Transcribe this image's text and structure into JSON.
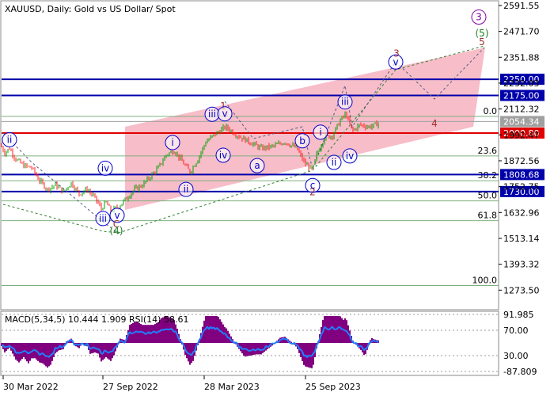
{
  "title": "XAUUSD, Daily:  Gold vs US Dollar/ Spot",
  "colors": {
    "bull": "#00a000",
    "bear": "#ff2020",
    "channel": "#f6b2c0",
    "blue_level": "#0000aa",
    "red_level": "#e00000",
    "fib_line": "#80b080",
    "circle": "#0000cc",
    "wave_major": "#a03030",
    "wave_green": "#208020",
    "wave_purple": "#8000a0",
    "macd_pos": "#800080",
    "macd_line": "#2080ff"
  },
  "chart_data": {
    "type": "candlestick",
    "symbol": "XAUUSD",
    "timeframe": "Daily",
    "y_axis_ticks": [
      "2591.55",
      "2471.70",
      "2351.88",
      "2232.03",
      "2112.32",
      "1992.47",
      "1872.56",
      "1752.75",
      "1632.96",
      "1513.14",
      "1393.32",
      "1273.50"
    ],
    "ylim": [
      1205,
      2595
    ],
    "x_axis_labels": [
      "30 Mar 2022",
      "27 Sep 2022",
      "28 Mar 2023",
      "25 Sep 2023"
    ],
    "price_path": [
      [
        0,
        1950
      ],
      [
        6,
        1910
      ],
      [
        12,
        1930
      ],
      [
        20,
        1880
      ],
      [
        30,
        1850
      ],
      [
        40,
        1840
      ],
      [
        50,
        1780
      ],
      [
        60,
        1740
      ],
      [
        70,
        1760
      ],
      [
        80,
        1730
      ],
      [
        90,
        1770
      ],
      [
        100,
        1720
      ],
      [
        110,
        1740
      ],
      [
        120,
        1700
      ],
      [
        128,
        1650
      ],
      [
        134,
        1680
      ],
      [
        140,
        1640
      ],
      [
        150,
        1660
      ],
      [
        160,
        1700
      ],
      [
        170,
        1740
      ],
      [
        180,
        1760
      ],
      [
        190,
        1800
      ],
      [
        200,
        1840
      ],
      [
        210,
        1900
      ],
      [
        220,
        1920
      ],
      [
        230,
        1870
      ],
      [
        240,
        1820
      ],
      [
        250,
        1880
      ],
      [
        260,
        1960
      ],
      [
        270,
        1990
      ],
      [
        285,
        2030
      ],
      [
        300,
        1990
      ],
      [
        315,
        1960
      ],
      [
        330,
        1930
      ],
      [
        345,
        1940
      ],
      [
        360,
        1960
      ],
      [
        375,
        1930
      ],
      [
        385,
        1860
      ],
      [
        395,
        1830
      ],
      [
        400,
        1900
      ],
      [
        410,
        1980
      ],
      [
        420,
        1990
      ],
      [
        430,
        2060
      ],
      [
        437,
        2090
      ],
      [
        445,
        2010
      ],
      [
        455,
        2040
      ],
      [
        465,
        2030
      ],
      [
        472,
        2035
      ],
      [
        480,
        2052
      ]
    ],
    "levels": [
      {
        "label": "2250.00",
        "value": 2250.0,
        "color": "blue"
      },
      {
        "label": "2175.00",
        "value": 2175.0,
        "color": "blue"
      },
      {
        "label": "2054.34",
        "value": 2054.34,
        "color": "gray"
      },
      {
        "label": "2000.80",
        "value": 2000.8,
        "color": "red"
      },
      {
        "label": "1808.68",
        "value": 1808.68,
        "color": "blue"
      },
      {
        "label": "1730.00",
        "value": 1730.0,
        "color": "blue"
      }
    ],
    "fibonacci": [
      {
        "label": "0.0",
        "value": 2078
      },
      {
        "label": "23.6",
        "value": 1895
      },
      {
        "label": "38.2",
        "value": 1780
      },
      {
        "label": "50.0",
        "value": 1687
      },
      {
        "label": "61.8",
        "value": 1595
      },
      {
        "label": "100.0",
        "value": 1295
      }
    ],
    "wave_labels": [
      {
        "text": "ii",
        "x": 12,
        "value": 1970,
        "style": "circle"
      },
      {
        "text": "iii",
        "x": 130,
        "value": 1605,
        "style": "circle"
      },
      {
        "text": "iv",
        "x": 133,
        "value": 1838,
        "style": "circle"
      },
      {
        "text": "v",
        "x": 148,
        "value": 1620,
        "style": "circle"
      },
      {
        "text": "C",
        "x": 147,
        "value": 1580,
        "style": "major"
      },
      {
        "text": "(4)",
        "x": 147,
        "value": 1548,
        "style": "green"
      },
      {
        "text": "i",
        "x": 218,
        "value": 1957,
        "style": "circle"
      },
      {
        "text": "ii",
        "x": 235,
        "value": 1740,
        "style": "circle"
      },
      {
        "text": "1",
        "x": 282,
        "value": 2126,
        "style": "major"
      },
      {
        "text": "iii",
        "x": 268,
        "value": 2088,
        "style": "circle"
      },
      {
        "text": "v",
        "x": 284,
        "value": 2090,
        "style": "circle"
      },
      {
        "text": "iv",
        "x": 282,
        "value": 1898,
        "style": "circle"
      },
      {
        "text": "a",
        "x": 325,
        "value": 1850,
        "style": "circle"
      },
      {
        "text": "b",
        "x": 382,
        "value": 1965,
        "style": "circle"
      },
      {
        "text": "c",
        "x": 395,
        "value": 1758,
        "style": "circle"
      },
      {
        "text": "2",
        "x": 395,
        "value": 1728,
        "style": "major"
      },
      {
        "text": "i",
        "x": 405,
        "value": 2005,
        "style": "circle"
      },
      {
        "text": "ii",
        "x": 422,
        "value": 1865,
        "style": "circle"
      },
      {
        "text": "iii",
        "x": 436,
        "value": 2145,
        "style": "circle"
      },
      {
        "text": "iv",
        "x": 442,
        "value": 1895,
        "style": "circle"
      },
      {
        "text": "v",
        "x": 500,
        "value": 2330,
        "style": "circle"
      },
      {
        "text": "3",
        "x": 501,
        "value": 2370,
        "style": "major"
      },
      {
        "text": "4",
        "x": 549,
        "value": 2045,
        "style": "major"
      },
      {
        "text": "5",
        "x": 609,
        "value": 2422,
        "style": "major"
      },
      {
        "text": "(5)",
        "x": 609,
        "value": 2463,
        "style": "green"
      },
      {
        "text": "3",
        "x": 605,
        "value": 2538,
        "style": "purple_circle"
      }
    ]
  },
  "indicator": {
    "label": "MACD(5,34,5) 10.444 1.909 RSI(14) 58.61",
    "y_ticks": [
      "91.985",
      "70.00",
      "30.00",
      "-87.809"
    ]
  }
}
